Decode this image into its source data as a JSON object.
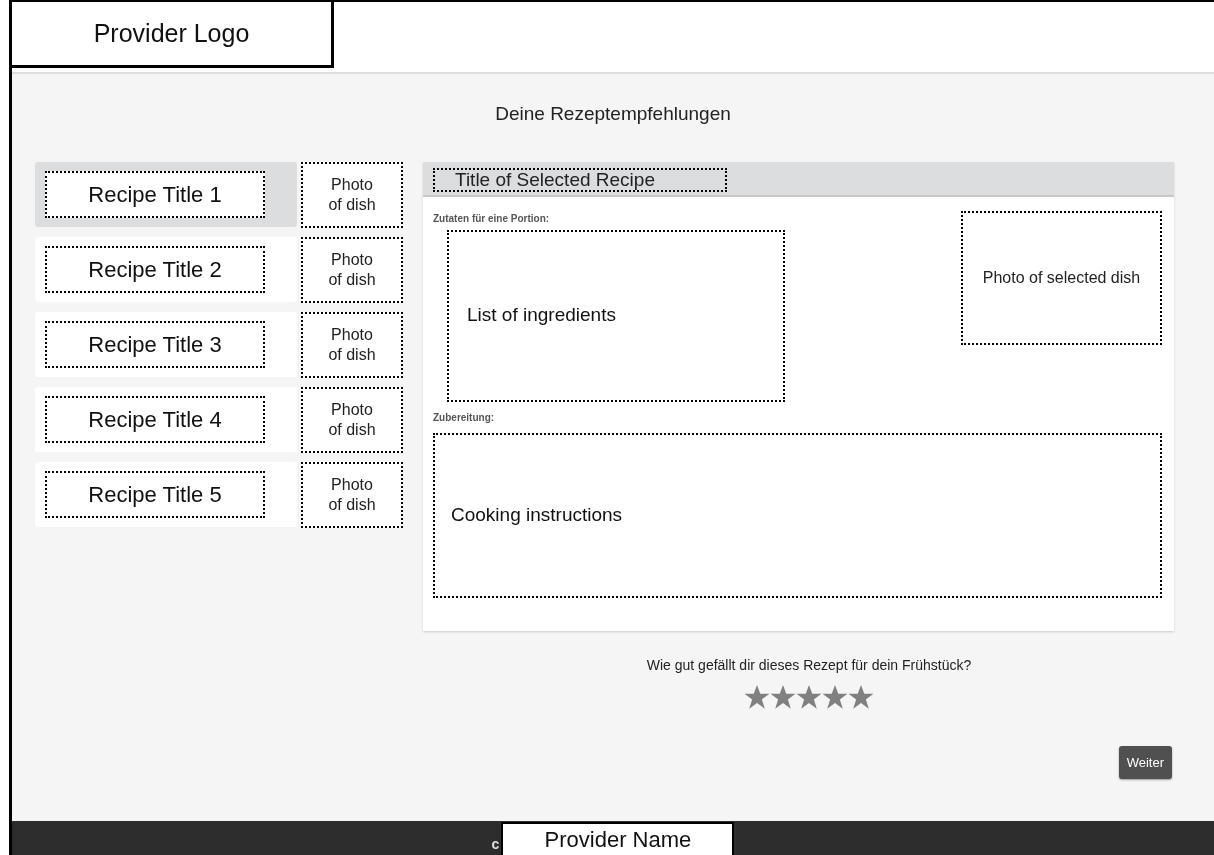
{
  "header": {
    "logo": "Provider Logo"
  },
  "page_title": "Deine Rezeptempfehlungen",
  "recipes": [
    {
      "title": "Recipe Title 1",
      "photo": "Photo of dish",
      "selected": true
    },
    {
      "title": "Recipe Title 2",
      "photo": "Photo of dish",
      "selected": false
    },
    {
      "title": "Recipe Title 3",
      "photo": "Photo of dish",
      "selected": false
    },
    {
      "title": "Recipe Title 4",
      "photo": "Photo of dish",
      "selected": false
    },
    {
      "title": "Recipe Title 5",
      "photo": "Photo of dish",
      "selected": false
    }
  ],
  "detail": {
    "title": "Title of Selected Recipe",
    "ingredients_label": "Zutaten für eine Portion:",
    "ingredients": "List of ingredients",
    "photo": "Photo of selected dish",
    "instructions_label": "Zubereitung:",
    "instructions": "Cooking instructions"
  },
  "rating": {
    "question": "Wie gut gefällt dir dieses Rezept für dein Frühstück?",
    "stars": 5
  },
  "next_button": "Weiter",
  "footer": {
    "text": "c",
    "provider_name": "Provider Name"
  }
}
